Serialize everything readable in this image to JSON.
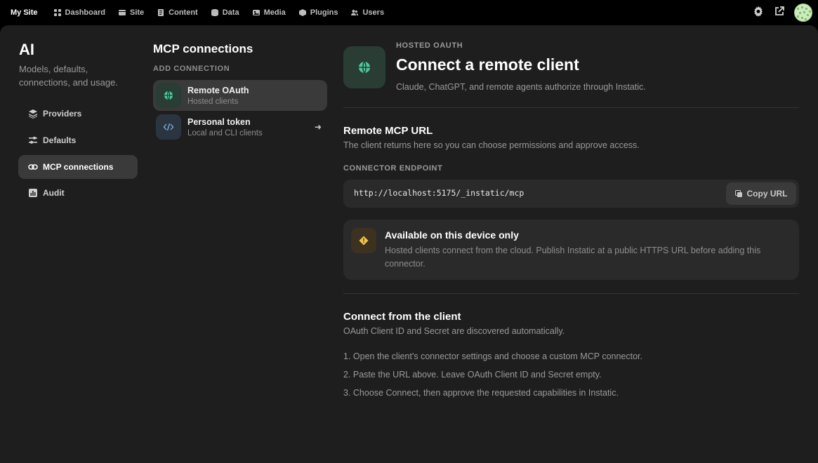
{
  "topbar": {
    "site_name": "My Site",
    "nav": [
      {
        "label": "Dashboard",
        "icon": "dashboard-icon"
      },
      {
        "label": "Site",
        "icon": "site-icon"
      },
      {
        "label": "Content",
        "icon": "content-icon"
      },
      {
        "label": "Data",
        "icon": "data-icon"
      },
      {
        "label": "Media",
        "icon": "media-icon"
      },
      {
        "label": "Plugins",
        "icon": "plugins-icon"
      },
      {
        "label": "Users",
        "icon": "users-icon"
      }
    ],
    "right_icons": [
      "gear-icon",
      "external-link-icon",
      "avatar"
    ]
  },
  "sidebar": {
    "title": "AI",
    "subtitle": "Models, defaults, connections, and usage.",
    "items": [
      {
        "label": "Providers",
        "icon": "layers-icon",
        "active": false
      },
      {
        "label": "Defaults",
        "icon": "sliders-icon",
        "active": false
      },
      {
        "label": "MCP connections",
        "icon": "link-icon",
        "active": true
      },
      {
        "label": "Audit",
        "icon": "bar-chart-icon",
        "active": false
      }
    ]
  },
  "connections": {
    "title": "MCP connections",
    "section_label": "ADD CONNECTION",
    "items": [
      {
        "title": "Remote OAuth",
        "subtitle": "Hosted clients",
        "icon": "globe-icon",
        "active": true
      },
      {
        "title": "Personal token",
        "subtitle": "Local and CLI clients",
        "icon": "code-icon",
        "active": false
      }
    ]
  },
  "detail": {
    "kicker": "HOSTED OAUTH",
    "title": "Connect a remote client",
    "subtitle": "Claude, ChatGPT, and remote agents authorize through Instatic.",
    "url_section": {
      "title": "Remote MCP URL",
      "subtitle": "The client returns here so you can choose permissions and approve access.",
      "endpoint_label": "CONNECTOR ENDPOINT",
      "endpoint": "http://localhost:5175/_instatic/mcp",
      "copy_label": "Copy URL"
    },
    "notice": {
      "title": "Available on this device only",
      "text": "Hosted clients connect from the cloud. Publish Instatic at a public HTTPS URL before adding this connector."
    },
    "client_section": {
      "title": "Connect from the client",
      "subtitle": "OAuth Client ID and Secret are discovered automatically.",
      "steps": [
        "1. Open the client's connector settings and choose a custom MCP connector.",
        "2. Paste the URL above. Leave OAuth Client ID and Secret empty.",
        "3. Choose Connect, then approve the requested capabilities in Instatic."
      ]
    }
  },
  "colors": {
    "accent_green": "#4fc9a0",
    "warning_yellow": "#f5c542",
    "panel_bg": "#1e1e1e"
  }
}
